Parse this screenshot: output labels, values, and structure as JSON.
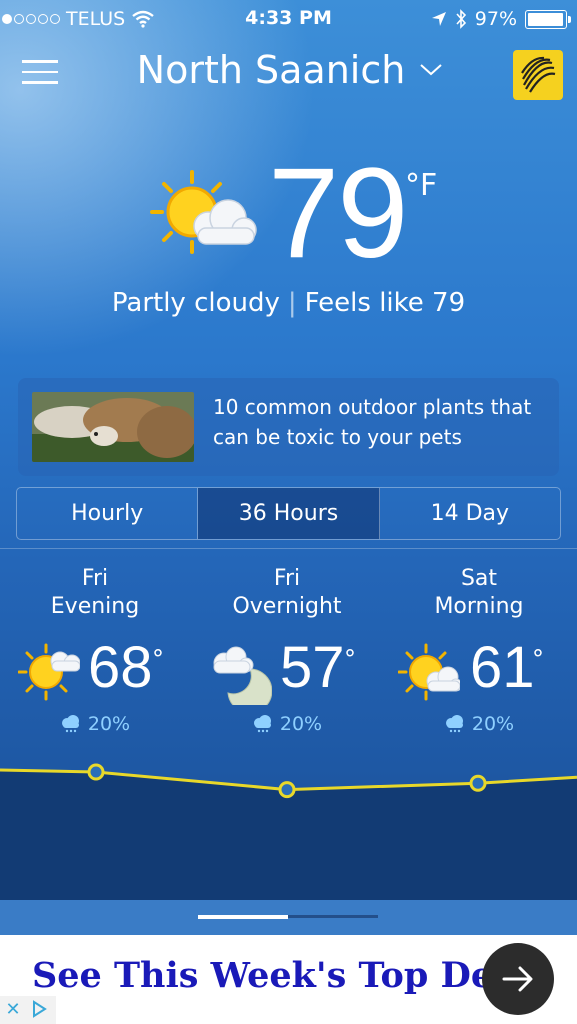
{
  "status_bar": {
    "carrier": "TELUS",
    "time": "4:33 PM",
    "battery": "97%",
    "battery_level": 0.97
  },
  "header": {
    "location": "North Saanich",
    "location_chevron": "chevron-down-icon",
    "menu_icon": "hamburger-menu-icon",
    "logo": "weather-channel-logo"
  },
  "current": {
    "temp": "79",
    "unit": "°F",
    "condition": "Partly cloudy",
    "separator": "|",
    "feels_like": "Feels like 79",
    "icon": "partly-cloudy-sun-icon"
  },
  "news": {
    "headline": "10 common outdoor plants that can be toxic to your pets",
    "thumbnail": "cat-photo"
  },
  "tabs": [
    {
      "label": "Hourly",
      "active": false
    },
    {
      "label": "36 Hours",
      "active": true
    },
    {
      "label": "14 Day",
      "active": false
    }
  ],
  "forecast": [
    {
      "day": "Fri",
      "period": "Evening",
      "temp": "68",
      "deg": "°",
      "precip": "20%",
      "icon": "partly-cloudy-sun-icon"
    },
    {
      "day": "Fri",
      "period": "Overnight",
      "temp": "57",
      "deg": "°",
      "precip": "20%",
      "icon": "partly-cloudy-moon-icon"
    },
    {
      "day": "Sat",
      "period": "Morning",
      "temp": "61",
      "deg": "°",
      "precip": "20%",
      "icon": "partly-cloudy-sun-icon"
    }
  ],
  "temp_trend": [
    68,
    57,
    61
  ],
  "pager": {
    "pages": 2,
    "current": 1
  },
  "ad": {
    "text": "See This Week's Top Deal",
    "arrow_icon": "arrow-right-icon",
    "close_icon": "close-icon",
    "adchoices_icon": "adchoices-icon"
  },
  "colors": {
    "precip": "#8fd0ff",
    "trend_line": "#e8d82a",
    "ad_text": "#1a1ab8",
    "logo_bg": "#f5d11f"
  }
}
